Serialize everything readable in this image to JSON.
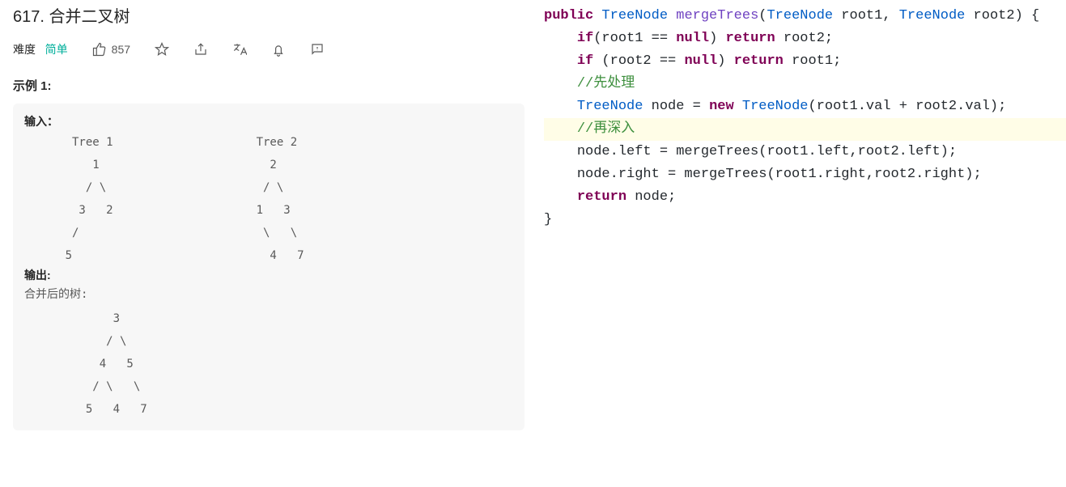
{
  "problem": {
    "number": "617.",
    "title": "合并二叉树",
    "difficulty_label": "难度",
    "difficulty_value": "简单",
    "likes": "857",
    "example_heading": "示例 1:",
    "input_label": "输入：",
    "output_label": "输出:",
    "output_sub": "合并后的树:",
    "trees_ascii": "       Tree 1                     Tree 2\n          1                         2\n         / \\                       / \\\n        3   2                     1   3\n       /                           \\   \\\n      5                             4   7",
    "merged_ascii": "             3\n            / \\\n           4   5\n          / \\   \\\n         5   4   7"
  },
  "code": {
    "t_public": "public",
    "t_TreeNode": "TreeNode",
    "t_mergeTrees": "mergeTrees",
    "t_root1": "root1",
    "t_root2": "root2",
    "t_if": "if",
    "t_null": "null",
    "t_return": "return",
    "t_new": "new",
    "t_node": "node",
    "c1": "//先处理",
    "c2": "//再深入",
    "sig_open": "(",
    "sig_mid": " root1, ",
    "sig_end": " root2) {",
    "line_if1_a": "(root1 == ",
    "line_if1_b": ") ",
    "line_if1_c": " root2;",
    "line_if2_a": " (root2 == ",
    "line_if2_b": ") ",
    "line_if2_c": " root1;",
    "line_new_a": " node = ",
    "line_new_b": "(root1.val + root2.val);",
    "line_left": "node.left = mergeTrees(root1.left,root2.left);",
    "line_right": "node.right = mergeTrees(root1.right,root2.right);",
    "line_ret": " node;",
    "brace_close": "}"
  }
}
